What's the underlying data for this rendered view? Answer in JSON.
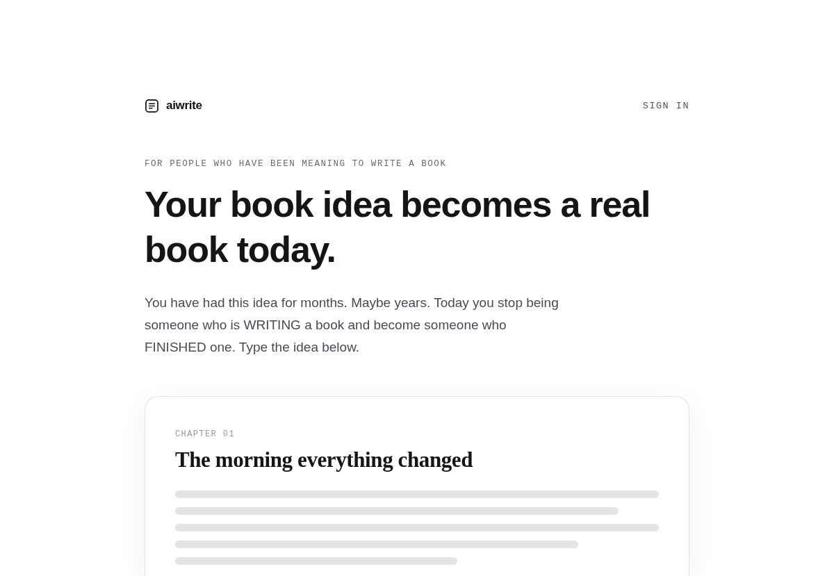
{
  "header": {
    "logo_text": "aiwrite",
    "sign_in": "SIGN IN"
  },
  "hero": {
    "eyebrow": "FOR PEOPLE WHO HAVE BEEN MEANING TO WRITE A BOOK",
    "headline": "Your book idea becomes a real book today.",
    "intro": "You have had this idea for months. Maybe years. Today you stop being someone who is WRITING a book and become someone who FINISHED one. Type the idea below."
  },
  "preview_card": {
    "chapter_label": "CHAPTER 01",
    "chapter_title": "The morning everything changed"
  }
}
